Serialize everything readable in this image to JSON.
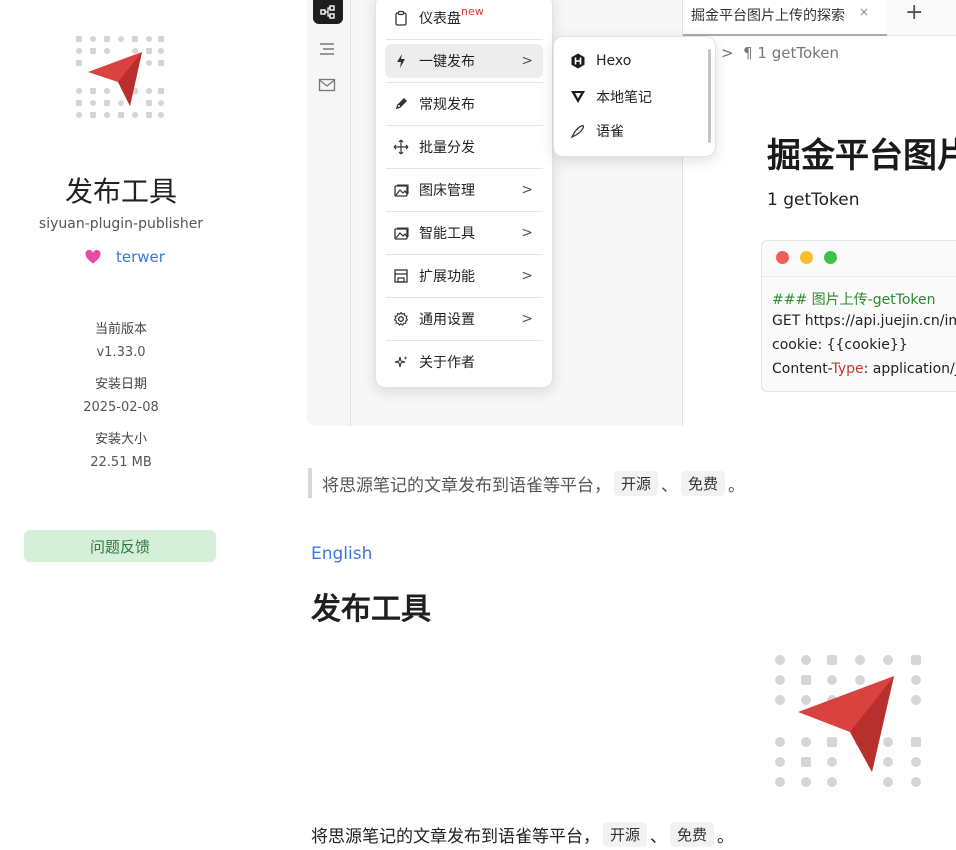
{
  "plugin": {
    "title": "发布工具",
    "package_name": "siyuan-plugin-publisher",
    "author": "terwer",
    "version_label": "当前版本",
    "version": "v1.33.0",
    "install_date_label": "安装日期",
    "install_date": "2025-02-08",
    "install_size_label": "安装大小",
    "install_size": "22.51 MB",
    "feedback_label": "问题反馈"
  },
  "preview": {
    "tab_title": "掘金平台图片上传的探索",
    "tab_close": "×",
    "tab_add": "+",
    "breadcrumb": "1 getToken",
    "doc_heading": "掘金平台图片",
    "doc_paragraph": "1 getToken",
    "code_lines": {
      "line1": "### 图片上传-getToken",
      "line2": "GET https://api.juejin.cn/im",
      "line3": "cookie: {{cookie}}",
      "line4_a": "Content-",
      "line4_b": "Type",
      "line4_c": ": application/j"
    },
    "tree_chevron": ">"
  },
  "menu": {
    "items": [
      {
        "label": "仪表盘",
        "badge": "new",
        "icon": "clipboard-icon"
      },
      {
        "label": "一键发布",
        "icon": "bolt-icon",
        "arrow": ">"
      },
      {
        "label": "常规发布",
        "icon": "pen-icon"
      },
      {
        "label": "批量分发",
        "icon": "move-icon"
      },
      {
        "label": "图床管理",
        "icon": "image-icon",
        "arrow": ">"
      },
      {
        "label": "智能工具",
        "icon": "image-icon",
        "arrow": ">"
      },
      {
        "label": "扩展功能",
        "icon": "store-icon",
        "arrow": ">"
      },
      {
        "label": "通用设置",
        "icon": "gear-icon",
        "arrow": ">"
      },
      {
        "label": "关于作者",
        "icon": "sparkle-icon"
      }
    ]
  },
  "submenu": {
    "items": [
      {
        "label": "Hexo",
        "icon": "hexo-icon"
      },
      {
        "label": "本地笔记",
        "icon": "vuepress-icon"
      },
      {
        "label": "语雀",
        "icon": "yuque-icon"
      }
    ]
  },
  "readme": {
    "quote_text": "将思源笔记的文章发布到语雀等平台，",
    "code_open_source": "开源",
    "separator": "、",
    "code_free": "免费",
    "period": "。",
    "english_link": "English",
    "heading": "发布工具",
    "paragraph_text": "将思源笔记的文章发布到语雀等平台，"
  },
  "colors": {
    "accent_link": "#3a78d8",
    "brand_red": "#d9423f",
    "feedback_bg": "#d6efd9",
    "feedback_text": "#2a7a3a"
  }
}
